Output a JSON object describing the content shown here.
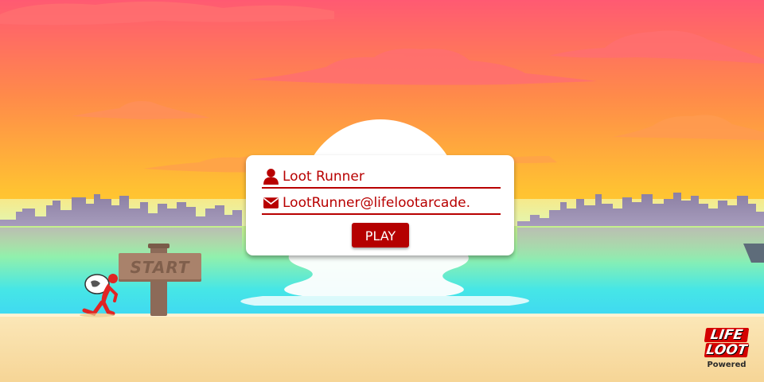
{
  "login": {
    "name_icon": "user-icon",
    "name_value": "Loot Runner",
    "email_icon": "envelope-icon",
    "email_value": "LootRunner@lifelootarcade.",
    "play_label": "PLAY"
  },
  "scene": {
    "sign_text": "START",
    "runner": "masked-thief-with-loot-sack"
  },
  "branding": {
    "logo_line1": "LIFE",
    "logo_line2": "LOOT",
    "powered_text": "Powered"
  },
  "colors": {
    "accent": "#b80000",
    "sky_top": "#ff5a72",
    "sky_mid": "#ffb236",
    "sky_low": "#ffe83a",
    "water": "#3fe6f0",
    "sand": "#f7dba0"
  }
}
